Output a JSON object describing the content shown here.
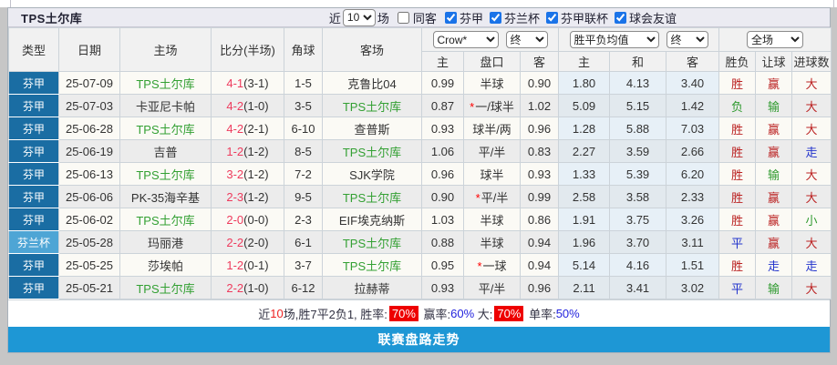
{
  "title": "TPS土尔库",
  "controls": {
    "recent_label": "近",
    "matches_value": "10",
    "matches_label": "场",
    "same_away_label": "同客",
    "same_away_checked": false,
    "leagues": [
      {
        "label": "芬甲",
        "checked": true
      },
      {
        "label": "芬兰杯",
        "checked": true
      },
      {
        "label": "芬甲联杯",
        "checked": true
      },
      {
        "label": "球会友谊",
        "checked": true
      }
    ]
  },
  "selectors": {
    "bookmaker": "Crow*",
    "handicap_time": "终",
    "europe": "胜平负均值",
    "europe_time": "终",
    "scope": "全场"
  },
  "header": {
    "main": [
      "类型",
      "日期",
      "主场",
      "比分(半场)",
      "角球",
      "客场"
    ],
    "sub": [
      "主",
      "盘口",
      "客",
      "主",
      "和",
      "客",
      "胜负",
      "让球",
      "进球数"
    ]
  },
  "rows": [
    {
      "type": "芬甲",
      "cup": false,
      "date": "25-07-09",
      "home": "TPS土尔库",
      "home_green": true,
      "score": "4-1",
      "half": "(3-1)",
      "corner": "1-5",
      "away": "克鲁比04",
      "away_green": false,
      "ah_home": "0.99",
      "handicap": "半球",
      "star": false,
      "ah_away": "0.90",
      "eu_home": "1.80",
      "eu_draw": "4.13",
      "eu_away": "3.40",
      "result": "胜",
      "result_c": "r",
      "let": "赢",
      "let_c": "r",
      "goal": "大",
      "goal_c": "r"
    },
    {
      "type": "芬甲",
      "cup": false,
      "date": "25-07-03",
      "home": "卡亚尼卡帕",
      "home_green": false,
      "score": "4-2",
      "half": "(1-0)",
      "corner": "3-5",
      "away": "TPS土尔库",
      "away_green": true,
      "ah_home": "0.87",
      "handicap": "一/球半",
      "star": true,
      "ah_away": "1.02",
      "eu_home": "5.09",
      "eu_draw": "5.15",
      "eu_away": "1.42",
      "result": "负",
      "result_c": "g",
      "let": "输",
      "let_c": "g",
      "goal": "大",
      "goal_c": "r"
    },
    {
      "type": "芬甲",
      "cup": false,
      "date": "25-06-28",
      "home": "TPS土尔库",
      "home_green": true,
      "score": "4-2",
      "half": "(2-1)",
      "corner": "6-10",
      "away": "查普斯",
      "away_green": false,
      "ah_home": "0.93",
      "handicap": "球半/两",
      "star": false,
      "ah_away": "0.96",
      "eu_home": "1.28",
      "eu_draw": "5.88",
      "eu_away": "7.03",
      "result": "胜",
      "result_c": "r",
      "let": "赢",
      "let_c": "r",
      "goal": "大",
      "goal_c": "r"
    },
    {
      "type": "芬甲",
      "cup": false,
      "date": "25-06-19",
      "home": "吉普",
      "home_green": false,
      "score": "1-2",
      "half": "(1-2)",
      "corner": "8-5",
      "away": "TPS土尔库",
      "away_green": true,
      "ah_home": "1.06",
      "handicap": "平/半",
      "star": false,
      "ah_away": "0.83",
      "eu_home": "2.27",
      "eu_draw": "3.59",
      "eu_away": "2.66",
      "result": "胜",
      "result_c": "r",
      "let": "赢",
      "let_c": "r",
      "goal": "走",
      "goal_c": "b"
    },
    {
      "type": "芬甲",
      "cup": false,
      "date": "25-06-13",
      "home": "TPS土尔库",
      "home_green": true,
      "score": "3-2",
      "half": "(1-2)",
      "corner": "7-2",
      "away": "SJK学院",
      "away_green": false,
      "ah_home": "0.96",
      "handicap": "球半",
      "star": false,
      "ah_away": "0.93",
      "eu_home": "1.33",
      "eu_draw": "5.39",
      "eu_away": "6.20",
      "result": "胜",
      "result_c": "r",
      "let": "输",
      "let_c": "g",
      "goal": "大",
      "goal_c": "r"
    },
    {
      "type": "芬甲",
      "cup": false,
      "date": "25-06-06",
      "home": "PK-35海辛基",
      "home_green": false,
      "score": "2-3",
      "half": "(1-2)",
      "corner": "9-5",
      "away": "TPS土尔库",
      "away_green": true,
      "ah_home": "0.90",
      "handicap": "平/半",
      "star": true,
      "ah_away": "0.99",
      "eu_home": "2.58",
      "eu_draw": "3.58",
      "eu_away": "2.33",
      "result": "胜",
      "result_c": "r",
      "let": "赢",
      "let_c": "r",
      "goal": "大",
      "goal_c": "r"
    },
    {
      "type": "芬甲",
      "cup": false,
      "date": "25-06-02",
      "home": "TPS土尔库",
      "home_green": true,
      "score": "2-0",
      "half": "(0-0)",
      "corner": "2-3",
      "away": "EIF埃克纳斯",
      "away_green": false,
      "ah_home": "1.03",
      "handicap": "半球",
      "star": false,
      "ah_away": "0.86",
      "eu_home": "1.91",
      "eu_draw": "3.75",
      "eu_away": "3.26",
      "result": "胜",
      "result_c": "r",
      "let": "赢",
      "let_c": "r",
      "goal": "小",
      "goal_c": "g"
    },
    {
      "type": "芬兰杯",
      "cup": true,
      "date": "25-05-28",
      "home": "玛丽港",
      "home_green": false,
      "score": "2-2",
      "half": "(2-0)",
      "corner": "6-1",
      "away": "TPS土尔库",
      "away_green": true,
      "ah_home": "0.88",
      "handicap": "半球",
      "star": false,
      "ah_away": "0.94",
      "eu_home": "1.96",
      "eu_draw": "3.70",
      "eu_away": "3.11",
      "result": "平",
      "result_c": "b",
      "let": "赢",
      "let_c": "r",
      "goal": "大",
      "goal_c": "r"
    },
    {
      "type": "芬甲",
      "cup": false,
      "date": "25-05-25",
      "home": "莎埃帕",
      "home_green": false,
      "score": "1-2",
      "half": "(0-1)",
      "corner": "3-7",
      "away": "TPS土尔库",
      "away_green": true,
      "ah_home": "0.95",
      "handicap": "一球",
      "star": true,
      "ah_away": "0.94",
      "eu_home": "5.14",
      "eu_draw": "4.16",
      "eu_away": "1.51",
      "result": "胜",
      "result_c": "r",
      "let": "走",
      "let_c": "b",
      "goal": "走",
      "goal_c": "b"
    },
    {
      "type": "芬甲",
      "cup": false,
      "date": "25-05-21",
      "home": "TPS土尔库",
      "home_green": true,
      "score": "2-2",
      "half": "(1-0)",
      "corner": "6-12",
      "away": "拉赫蒂",
      "away_green": false,
      "ah_home": "0.93",
      "handicap": "平/半",
      "star": false,
      "ah_away": "0.96",
      "eu_home": "2.11",
      "eu_draw": "3.41",
      "eu_away": "3.02",
      "result": "平",
      "result_c": "b",
      "let": "输",
      "let_c": "g",
      "goal": "大",
      "goal_c": "r"
    }
  ],
  "summary": {
    "segments": [
      {
        "text": "近",
        "style": "plain"
      },
      {
        "text": "10",
        "style": "red"
      },
      {
        "text": "场,胜7平2负1, 胜率:",
        "style": "plain"
      },
      {
        "text": "70%",
        "style": "badge"
      },
      {
        "text": " 赢率:",
        "style": "plain"
      },
      {
        "text": "60%",
        "style": "blue"
      },
      {
        "text": " 大:",
        "style": "plain"
      },
      {
        "text": "70%",
        "style": "badge"
      },
      {
        "text": " 单率:",
        "style": "plain"
      },
      {
        "text": "50%",
        "style": "blue"
      }
    ]
  },
  "footer": {
    "label": "联赛盘路走势"
  },
  "colors": {
    "league_type_bg": "#1a6da3",
    "cup_type_bg": "#4ea5d5",
    "team_green": "#33a033",
    "score_red": "#ee3b5d",
    "win_red": "#bb2222",
    "lose_green": "#2f9a2f",
    "draw_blue": "#2233cc",
    "badge_red": "#ee0000",
    "percent_blue": "#2323dd",
    "footer_blue": "#1e97d5",
    "checkbox_blue": "#1a73e8"
  }
}
